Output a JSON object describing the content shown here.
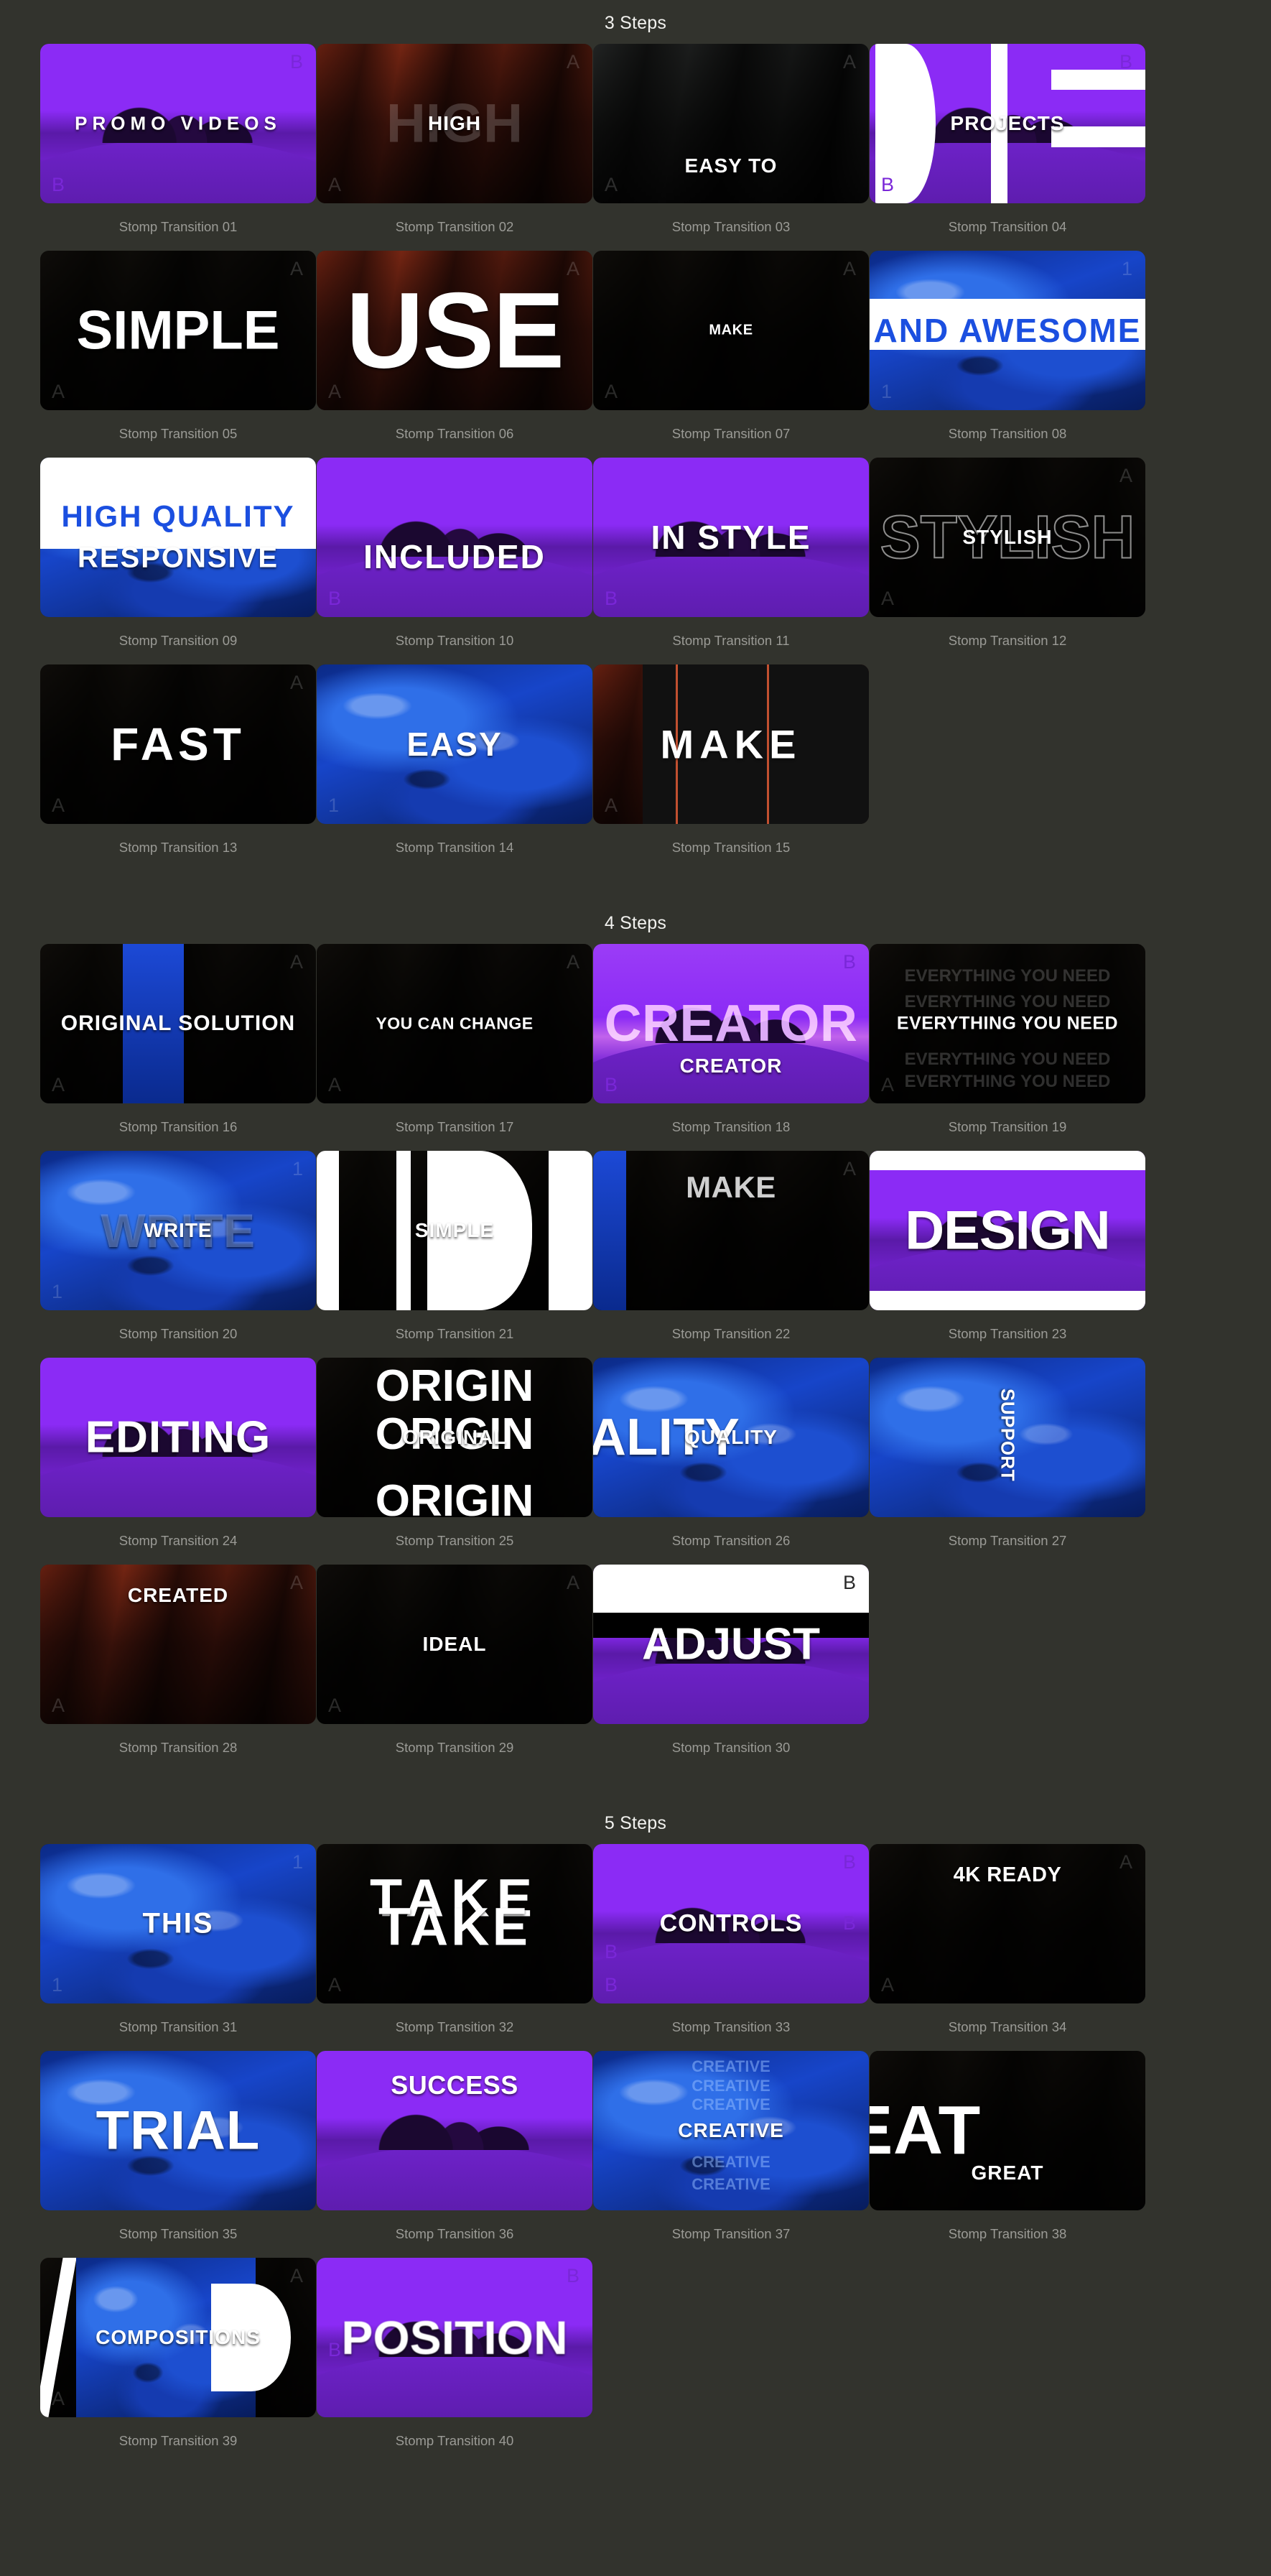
{
  "page": {
    "background_color": "#32332d",
    "caption_color": "#9b9b96",
    "header_color": "#f2f2ef",
    "accent_purple": "#8b2bf5",
    "accent_blue": "#1b4fe0"
  },
  "sections": [
    {
      "title": "3 Steps",
      "items": [
        {
          "caption": "Stomp Transition 01",
          "overlay_text": "PROMO VIDEOS",
          "marker_letters": [
            "B",
            "B"
          ],
          "style": "purple-scene"
        },
        {
          "caption": "Stomp Transition 02",
          "overlay_text": "HIGH",
          "ghost_text": "HIGH",
          "marker_letters": [
            "A",
            "A"
          ],
          "style": "rock-red"
        },
        {
          "caption": "Stomp Transition 03",
          "overlay_text": "EASY TO",
          "marker_letters": [
            "A",
            "A"
          ],
          "style": "rock-grey"
        },
        {
          "caption": "Stomp Transition 04",
          "overlay_text": "PROJECTS",
          "marker_letters": [
            "B",
            "B"
          ],
          "style": "purple-scene"
        },
        {
          "caption": "Stomp Transition 05",
          "overlay_text": "SIMPLE",
          "marker_letters": [
            "A",
            "A"
          ],
          "style": "rock-dark"
        },
        {
          "caption": "Stomp Transition 06",
          "overlay_text": "USE",
          "marker_letters": [
            "A",
            "A"
          ],
          "style": "rock-red"
        },
        {
          "caption": "Stomp Transition 07",
          "overlay_text": "MAKE",
          "marker_letters": [
            "A",
            "A"
          ],
          "style": "rock-dark"
        },
        {
          "caption": "Stomp Transition 08",
          "overlay_text": "AND AWESOME",
          "marker_letters": [
            "1",
            "1"
          ],
          "style": "blue-hands"
        },
        {
          "caption": "Stomp Transition 09",
          "overlay_text": "HIGH QUALITY",
          "overlay_text_2": "RESPONSIVE",
          "marker_letters": [],
          "style": "blue-hands"
        },
        {
          "caption": "Stomp Transition 10",
          "overlay_text": "INCLUDED",
          "marker_letters": [
            "B"
          ],
          "style": "purple-scene"
        },
        {
          "caption": "Stomp Transition 11",
          "overlay_text": "IN STYLE",
          "marker_letters": [
            "B"
          ],
          "style": "purple-scene"
        },
        {
          "caption": "Stomp Transition 12",
          "overlay_text": "STYLISH",
          "ghost_text": "STYLISH",
          "marker_letters": [
            "A",
            "A"
          ],
          "style": "rock-dark"
        },
        {
          "caption": "Stomp Transition 13",
          "overlay_text": "FAST",
          "marker_letters": [
            "A",
            "A"
          ],
          "style": "rock-dark"
        },
        {
          "caption": "Stomp Transition 14",
          "overlay_text": "EASY",
          "marker_letters": [
            "1"
          ],
          "style": "blue-hands"
        },
        {
          "caption": "Stomp Transition 15",
          "overlay_text": "MAKE",
          "marker_letters": [
            "A"
          ],
          "style": "rock-red"
        }
      ]
    },
    {
      "title": "4 Steps",
      "items": [
        {
          "caption": "Stomp Transition 16",
          "overlay_text": "ORIGINAL SOLUTION",
          "marker_letters": [
            "A",
            "A"
          ],
          "style": "rock-dark"
        },
        {
          "caption": "Stomp Transition 17",
          "overlay_text": "YOU CAN CHANGE",
          "marker_letters": [
            "A",
            "A"
          ],
          "style": "rock-dark"
        },
        {
          "caption": "Stomp Transition 18",
          "overlay_text": "CREATOR",
          "overlay_text_2": "CREATOR",
          "marker_letters": [
            "B",
            "B"
          ],
          "style": "purple-scene"
        },
        {
          "caption": "Stomp Transition 19",
          "overlay_text": "EVERYTHING YOU NEED",
          "marker_letters": [
            "A"
          ],
          "style": "rock-dark"
        },
        {
          "caption": "Stomp Transition 20",
          "overlay_text": "WRITE",
          "marker_letters": [
            "1",
            "1"
          ],
          "style": "blue-hands"
        },
        {
          "caption": "Stomp Transition 21",
          "overlay_text": "SIMPLE",
          "marker_letters": [],
          "style": "rock-dark"
        },
        {
          "caption": "Stomp Transition 22",
          "overlay_text": "MAKE",
          "marker_letters": [
            "A"
          ],
          "style": "rock-dark"
        },
        {
          "caption": "Stomp Transition 23",
          "overlay_text": "DESIGN",
          "marker_letters": [],
          "style": "purple-scene"
        },
        {
          "caption": "Stomp Transition 24",
          "overlay_text": "EDITING",
          "marker_letters": [],
          "style": "purple-scene"
        },
        {
          "caption": "Stomp Transition 25",
          "overlay_text": "ORIGINAL",
          "ghost_text": "ORIGIN",
          "marker_letters": [],
          "style": "rock-dark"
        },
        {
          "caption": "Stomp Transition 26",
          "overlay_text": "QUALITY",
          "marker_letters": [],
          "style": "blue-hands"
        },
        {
          "caption": "Stomp Transition 27",
          "overlay_text": "SUPPORT",
          "marker_letters": [],
          "style": "blue-hands"
        },
        {
          "caption": "Stomp Transition 28",
          "overlay_text": "CREATED",
          "marker_letters": [
            "A",
            "A"
          ],
          "style": "rock-red"
        },
        {
          "caption": "Stomp Transition 29",
          "overlay_text": "IDEAL",
          "overlay_text_2": "IDEAL",
          "marker_letters": [
            "A",
            "A"
          ],
          "style": "rock-dark"
        },
        {
          "caption": "Stomp Transition 30",
          "overlay_text": "ADJUST",
          "marker_letters": [
            "B"
          ],
          "style": "purple-scene"
        }
      ]
    },
    {
      "title": "5 Steps",
      "items": [
        {
          "caption": "Stomp Transition 31",
          "overlay_text": "THIS",
          "marker_letters": [
            "1",
            "1"
          ],
          "style": "blue-hands"
        },
        {
          "caption": "Stomp Transition 32",
          "overlay_text": "TAKE",
          "ghost_text": "TAKE",
          "marker_letters": [
            "A"
          ],
          "style": "rock-dark"
        },
        {
          "caption": "Stomp Transition 33",
          "overlay_text": "CONTROLS",
          "marker_letters": [
            "B",
            "B",
            "B",
            "B"
          ],
          "style": "purple-scene"
        },
        {
          "caption": "Stomp Transition 34",
          "overlay_text": "4K READY",
          "marker_letters": [
            "A",
            "A"
          ],
          "style": "rock-dark"
        },
        {
          "caption": "Stomp Transition 35",
          "overlay_text": "TRIAL",
          "marker_letters": [],
          "style": "blue-hands"
        },
        {
          "caption": "Stomp Transition 36",
          "overlay_text": "SUCCESS",
          "marker_letters": [],
          "style": "purple-scene"
        },
        {
          "caption": "Stomp Transition 37",
          "overlay_text": "CREATIVE",
          "ghost_text": "CREATIVE",
          "marker_letters": [],
          "style": "blue-hands"
        },
        {
          "caption": "Stomp Transition 38",
          "overlay_text": "GREAT",
          "ghost_text": "GREAT",
          "marker_letters": [],
          "style": "rock-dark"
        },
        {
          "caption": "Stomp Transition 39",
          "overlay_text": "COMPOSITIONS",
          "marker_letters": [
            "A",
            "A"
          ],
          "style": "blue-hands"
        },
        {
          "caption": "Stomp Transition 40",
          "overlay_text": "POSITION",
          "marker_letters": [
            "B",
            "B"
          ],
          "style": "purple-scene"
        }
      ]
    }
  ]
}
